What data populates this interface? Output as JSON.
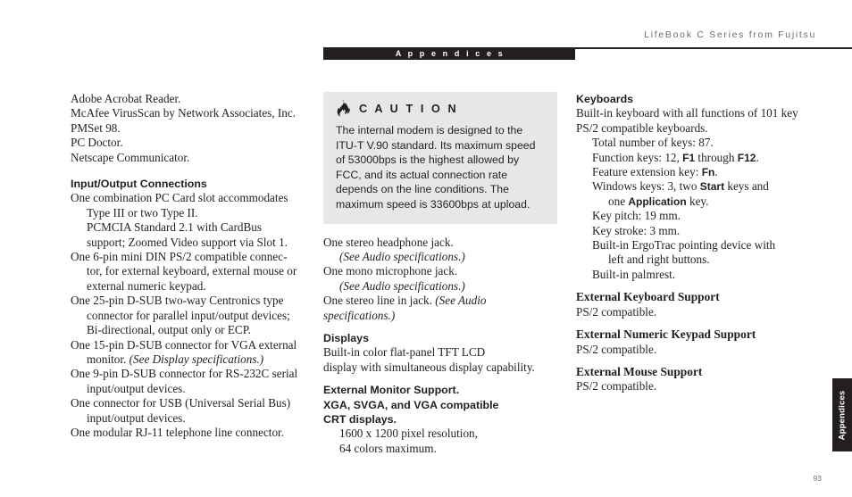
{
  "page": {
    "running_head": "LifeBook C Series from Fujitsu",
    "section_bar_label": "A p p e n d i c e s",
    "thumb_tab_label": "Appendices",
    "folio": "93",
    "colors": {
      "ink": "#231f20",
      "muted": "#6c6c6c",
      "caution_background": "#e7e7e7",
      "bar_background": "#231f20",
      "page_background": "#ffffff"
    }
  },
  "left_column": {
    "software_list": [
      "Adobe Acrobat Reader.",
      "McAfee VirusScan by Network Associates, Inc.",
      "PMSet 98.",
      "PC Doctor.",
      "Netscape Communicator."
    ],
    "io_heading": "Input/Output Connections",
    "io_lines": [
      "One combination PC Card slot accommodates",
      "Type III or two Type II.",
      "PCMCIA Standard 2.1 with CardBus",
      "support; Zoomed Video support via Slot 1.",
      "One 6-pin mini DIN PS/2 compatible connec-",
      "tor, for external keyboard, external mouse or",
      "external numeric keypad.",
      "One 25-pin D-SUB two-way Centronics type",
      "connector for parallel input/output devices;",
      "Bi-directional, output only or ECP.",
      "One 15-pin D-SUB connector for VGA external",
      "One 9-pin D-SUB connector for RS-232C serial",
      "input/output devices.",
      "One connector for USB (Universal Serial Bus)",
      "input/output devices.",
      "One modular RJ-11 telephone line connector."
    ],
    "vga_monitor_prefix": "monitor. ",
    "vga_monitor_ref": "(See Display specifications.)"
  },
  "center_column": {
    "caution": {
      "icon_name": "flame-icon",
      "title": "C A U T I O N",
      "body_lines": [
        "The internal modem is designed to the",
        "ITU-T V.90 standard. Its maximum speed",
        "of 53000bps is the highest allowed by",
        "FCC, and its actual connection rate",
        "depends on the line conditions. The",
        "maximum speed is 33600bps at upload."
      ]
    },
    "audio_lines": {
      "headphone": "One stereo headphone jack.",
      "headphone_ref": "(See Audio specifications.)",
      "microphone": "One mono microphone jack.",
      "microphone_ref": "(See Audio specifications.)",
      "line_in_prefix": "One stereo line in jack. ",
      "line_in_ref": "(See Audio specifications.)"
    },
    "displays_heading": "Displays",
    "displays_lines": [
      "Built-in color flat-panel TFT LCD",
      "display with simultaneous display capability."
    ],
    "external_monitor_heading_lines": [
      "External Monitor Support.",
      "XGA, SVGA, and VGA compatible",
      "CRT displays."
    ],
    "external_monitor_specs": [
      "1600 x 1200 pixel resolution,",
      "64 colors maximum."
    ]
  },
  "right_column": {
    "keyboards_heading": "Keyboards",
    "keyboards_intro": [
      "Built-in keyboard with all functions of 101 key",
      "PS/2 compatible keyboards."
    ],
    "keyboard_specs": {
      "total_keys": "Total number of keys: 87.",
      "function_keys_pre": "Function keys: 12, ",
      "function_keys_f1": "F1",
      "function_keys_mid": " through ",
      "function_keys_f12": "F12",
      "function_keys_post": ".",
      "feature_key_pre": "Feature extension key: ",
      "feature_key_fn": "Fn",
      "feature_key_post": ".",
      "windows_keys_pre": "Windows keys: 3, two ",
      "windows_keys_start": "Start",
      "windows_keys_post": " keys and",
      "windows_keys_line2_pre": "one ",
      "windows_keys_application": "Application",
      "windows_keys_line2_post": " key.",
      "key_pitch": "Key pitch: 19 mm.",
      "key_stroke": "Key stroke: 3 mm.",
      "ergotrac_line1": "Built-in ErgoTrac pointing device with",
      "ergotrac_line2": "left and right buttons.",
      "palmrest": "Built-in palmrest."
    },
    "support_sections": [
      {
        "heading": "External Keyboard Support",
        "body": "PS/2 compatible."
      },
      {
        "heading": "External Numeric Keypad Support",
        "body": "PS/2 compatible."
      },
      {
        "heading": "External Mouse Support",
        "body": "PS/2 compatible."
      }
    ]
  }
}
